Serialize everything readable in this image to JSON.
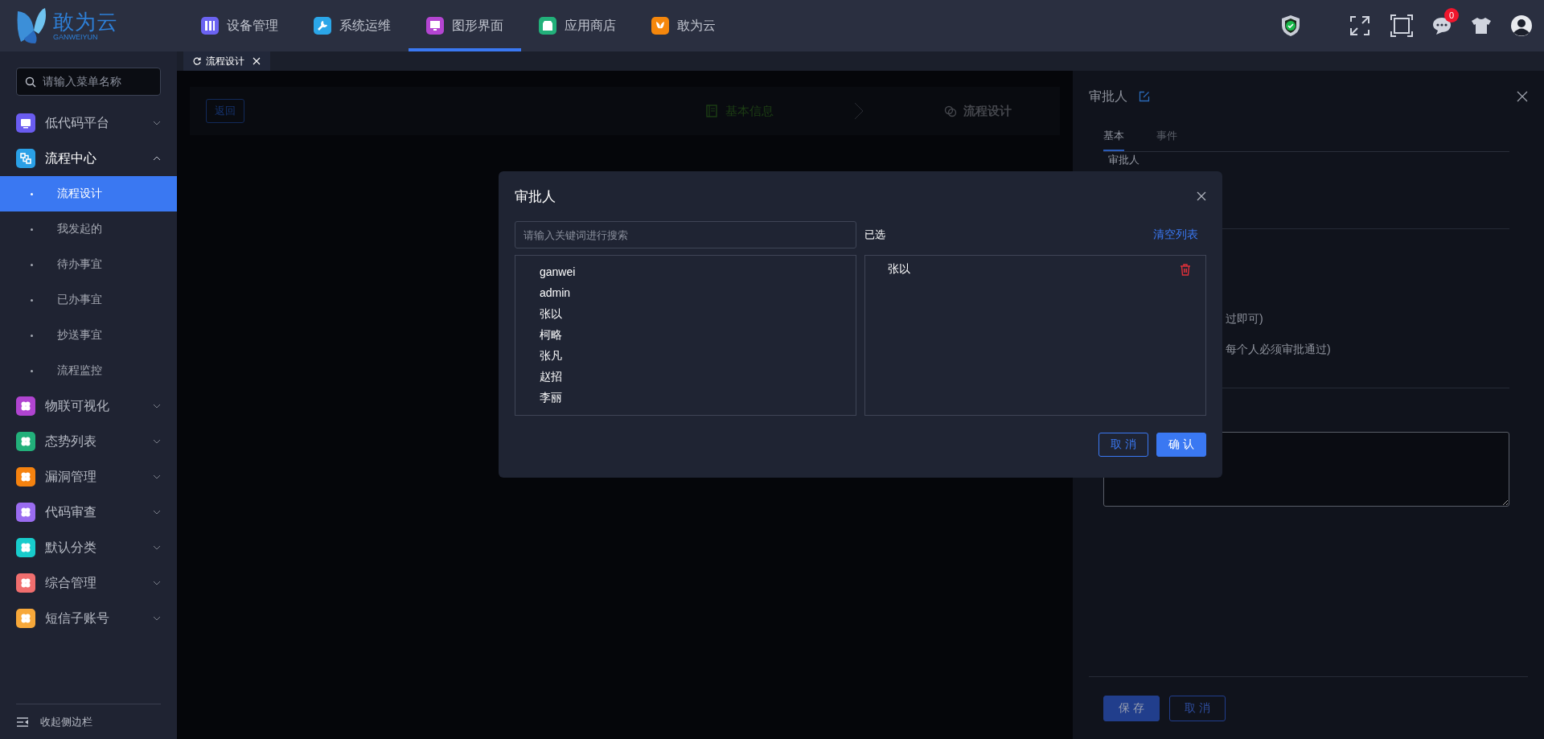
{
  "header": {
    "logo": {
      "name": "敢为云",
      "subtitle": "GANWEIYUN"
    },
    "nav": [
      {
        "label": "设备管理",
        "color": "#6b63f2",
        "selected": false
      },
      {
        "label": "系统运维",
        "color": "#2ba6e8",
        "selected": false
      },
      {
        "label": "图形界面",
        "color": "#b445d2",
        "selected": true
      },
      {
        "label": "应用商店",
        "color": "#22b07a",
        "selected": false
      },
      {
        "label": "敢为云",
        "color": "#f5870c",
        "selected": false
      }
    ],
    "notifications": {
      "badge": "0"
    }
  },
  "sidebar": {
    "search": {
      "placeholder": "请输入菜单名称"
    },
    "items": [
      {
        "label": "低代码平台",
        "color": "#6a5cf0",
        "expanded": false
      },
      {
        "label": "流程中心",
        "color": "#2aa0e6",
        "expanded": true,
        "children": [
          {
            "label": "流程设计",
            "selected": true
          },
          {
            "label": "我发起的",
            "selected": false
          },
          {
            "label": "待办事宜",
            "selected": false
          },
          {
            "label": "已办事宜",
            "selected": false
          },
          {
            "label": "抄送事宜",
            "selected": false
          },
          {
            "label": "流程监控",
            "selected": false
          }
        ]
      },
      {
        "label": "物联可视化",
        "color": "#b044d0",
        "expanded": false
      },
      {
        "label": "态势列表",
        "color": "#22b07a",
        "expanded": false
      },
      {
        "label": "漏洞管理",
        "color": "#f5820f",
        "expanded": false
      },
      {
        "label": "代码审查",
        "color": "#9a6cf0",
        "expanded": false
      },
      {
        "label": "默认分类",
        "color": "#18cccc",
        "expanded": false
      },
      {
        "label": "综合管理",
        "color": "#f06e6e",
        "expanded": false
      },
      {
        "label": "短信子账号",
        "color": "#f7a83a",
        "expanded": false
      }
    ],
    "collapse": "收起侧边栏"
  },
  "tabs": [
    {
      "label": "流程设计",
      "selected": true
    }
  ],
  "designer": {
    "back": "返回",
    "steps": [
      {
        "label": "基本信息",
        "finished": true
      },
      {
        "label": "流程设计",
        "finished": false
      }
    ]
  },
  "drawer": {
    "title": "审批人",
    "tabs": [
      {
        "label": "基本",
        "selected": true
      },
      {
        "label": "事件",
        "selected": false
      }
    ],
    "field_label": "审批人",
    "options": [
      "过即可)",
      "每个人必须审批通过)"
    ],
    "buttons": [
      "保存",
      "取消"
    ]
  },
  "dialog": {
    "title": "审批人",
    "search": {
      "placeholder": "请输入关键词进行搜索"
    },
    "selected_label": "已选",
    "clear": "清空列表",
    "users": [
      "ganwei",
      "admin",
      "张以",
      "柯略",
      "张凡",
      "赵招",
      "李丽"
    ],
    "selected_users": [
      "张以"
    ],
    "buttons": [
      "取消",
      "确认"
    ]
  }
}
